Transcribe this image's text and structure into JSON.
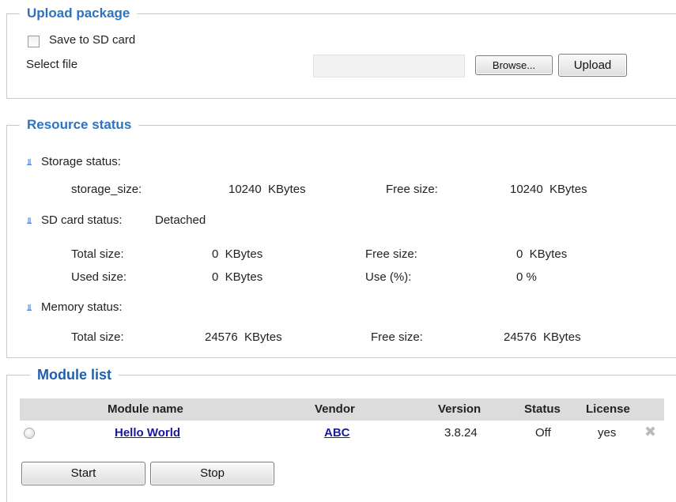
{
  "upload": {
    "legend": "Upload package",
    "save_sd_label": "Save to SD card",
    "select_file_label": "Select file",
    "browse_label": "Browse...",
    "upload_label": "Upload"
  },
  "resource": {
    "legend": "Resource status",
    "storage": {
      "heading": "Storage status:",
      "size_label": "storage_size:",
      "size_value": "10240  KBytes",
      "free_label": "Free size:",
      "free_value": "10240  KBytes"
    },
    "sd": {
      "heading": "SD card status:",
      "state": "Detached",
      "total_label": "Total size:",
      "total_value": "0  KBytes",
      "free_label": "Free size:",
      "free_value": "0  KBytes",
      "used_label": "Used size:",
      "used_value": "0  KBytes",
      "use_label": "Use (%):",
      "use_value": "0 %"
    },
    "memory": {
      "heading": "Memory status:",
      "total_label": "Total size:",
      "total_value": "24576  KBytes",
      "free_label": "Free size:",
      "free_value": "24576  KBytes"
    }
  },
  "modules": {
    "legend": "Module list",
    "columns": {
      "name": "Module name",
      "vendor": "Vendor",
      "version": "Version",
      "status": "Status",
      "license": "License"
    },
    "rows": [
      {
        "name": "Hello World",
        "vendor": "ABC",
        "version": "3.8.24",
        "status": "Off",
        "license": "yes"
      }
    ],
    "start_label": "Start",
    "stop_label": "Stop"
  },
  "icons": {
    "bullet": "double-chevron-down-icon",
    "remove": "close-icon"
  },
  "colors": {
    "legend": "#2e73c0",
    "link": "#1a1a9c",
    "table_header": "#dcdcdc"
  }
}
